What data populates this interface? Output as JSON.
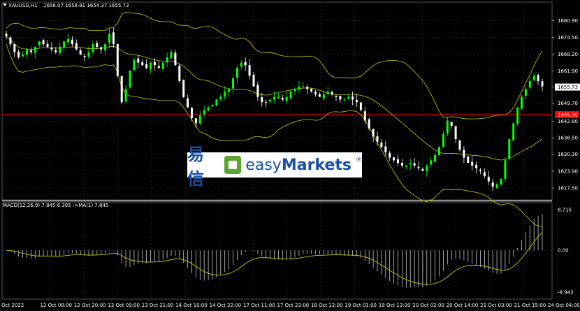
{
  "header": {
    "symbol": "XAUUSD,H1",
    "ohlc": "1656.07 1658.81 1654.37 1655.73"
  },
  "macd": {
    "label": "MACD(12,26,9) 7.845 6.395  ->MA(1) 7.845",
    "ticks": [
      "8.715",
      "0.00",
      "-8.943"
    ]
  },
  "watermark": {
    "cn": "易信",
    "en_light": "easy",
    "en_bold": "Markets",
    "reg": "®"
  },
  "colors": {
    "background": "#000000",
    "bull": "#00ff00",
    "bear": "#ffffff",
    "bands": "#c8c800",
    "price_line": "#ff0000",
    "price_label_bg": "#ff0000",
    "grid": "#3a3a3a",
    "separator": "#ffffff"
  },
  "chart_data": {
    "type": "candlestick",
    "symbol": "XAUUSD",
    "timeframe": "H1",
    "current_price": "1645.30",
    "last_close": "1655.73",
    "ylim": [
      1613.0,
      1685.0
    ],
    "y_ticks": [
      "1680.90",
      "1674.50",
      "1668.20",
      "1661.90",
      "1655.73",
      "1649.70",
      "1642.80",
      "1636.50",
      "1630.30",
      "1623.90",
      "1617.50"
    ],
    "x_ticks": [
      "11 Oct 2022",
      "12 Oct 08:00",
      "12 Oct 20:00",
      "13 Oct 09:00",
      "13 Oct 21:00",
      "14 Oct 10:00",
      "14 Oct 22:00",
      "17 Oct 11:00",
      "17 Oct 23:00",
      "18 Oct 12:00",
      "19 Oct 01:00",
      "19 Oct 13:00",
      "20 Oct 02:00",
      "20 Oct 14:00",
      "21 Oct 03:00",
      "21 Oct 15:00",
      "24 Oct 04:00"
    ],
    "close_path": [
      1675,
      1672,
      1669,
      1667,
      1668,
      1670,
      1669,
      1671,
      1673,
      1672,
      1671,
      1670,
      1669,
      1671,
      1673,
      1674,
      1672,
      1670,
      1668,
      1667,
      1669,
      1672,
      1671,
      1670,
      1672,
      1676,
      1672,
      1660,
      1650,
      1655,
      1662,
      1666,
      1665,
      1664,
      1663,
      1665,
      1664,
      1663,
      1665,
      1667,
      1669,
      1664,
      1658,
      1652,
      1648,
      1644,
      1642,
      1645,
      1647,
      1648,
      1649,
      1651,
      1652,
      1654,
      1655,
      1659,
      1663,
      1665,
      1664,
      1660,
      1656,
      1652,
      1650,
      1650,
      1651,
      1652,
      1652,
      1651,
      1652,
      1654,
      1655,
      1656,
      1656,
      1655,
      1654,
      1653,
      1652,
      1653,
      1654,
      1653,
      1652,
      1651,
      1651,
      1652,
      1651,
      1650,
      1647,
      1643,
      1640,
      1637,
      1635,
      1633,
      1631,
      1629,
      1628,
      1627,
      1626,
      1626,
      1627,
      1626,
      1625,
      1624,
      1626,
      1628,
      1630,
      1633,
      1638,
      1643,
      1641,
      1636,
      1632,
      1629,
      1627,
      1626,
      1625,
      1624,
      1622,
      1620,
      1618,
      1619,
      1621,
      1628,
      1636,
      1642,
      1648,
      1652,
      1655,
      1658,
      1660,
      1658,
      1656
    ],
    "macd_ylim": [
      -8.943,
      8.715
    ]
  }
}
